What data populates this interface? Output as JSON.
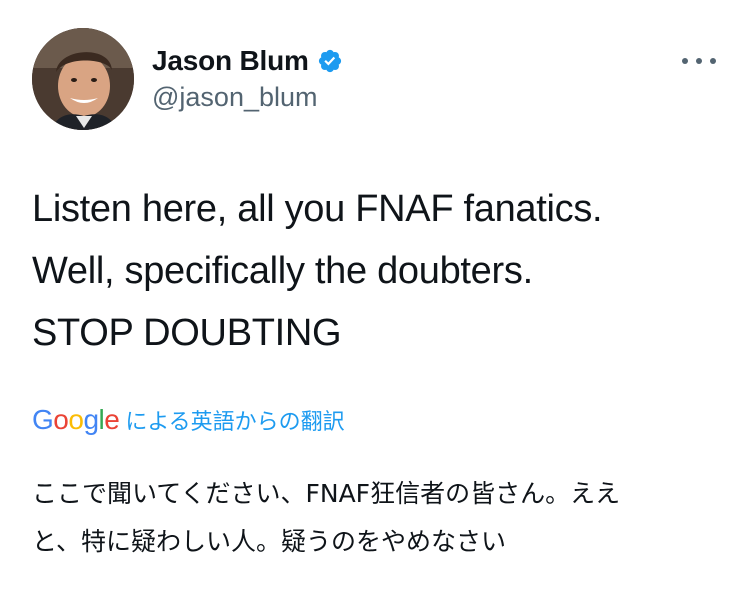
{
  "author": {
    "display_name": "Jason Blum",
    "handle": "@jason_blum",
    "verified": true,
    "verified_color": "#1d9bf0",
    "avatar": "profile-photo"
  },
  "menu": {
    "icon": "more-horizontal-icon"
  },
  "tweet": {
    "lines": [
      "Listen here, all you FNAF fanatics.",
      "Well, specifically the doubters.",
      "STOP DOUBTING"
    ]
  },
  "translation": {
    "provider": "Google",
    "label": "による英語からの翻訳",
    "link_color": "#1d9bf0",
    "lines": [
      "ここで聞いてください、FNAF狂信者の皆さん。ええ",
      "と、特に疑わしい人。疑うのをやめなさい"
    ]
  }
}
